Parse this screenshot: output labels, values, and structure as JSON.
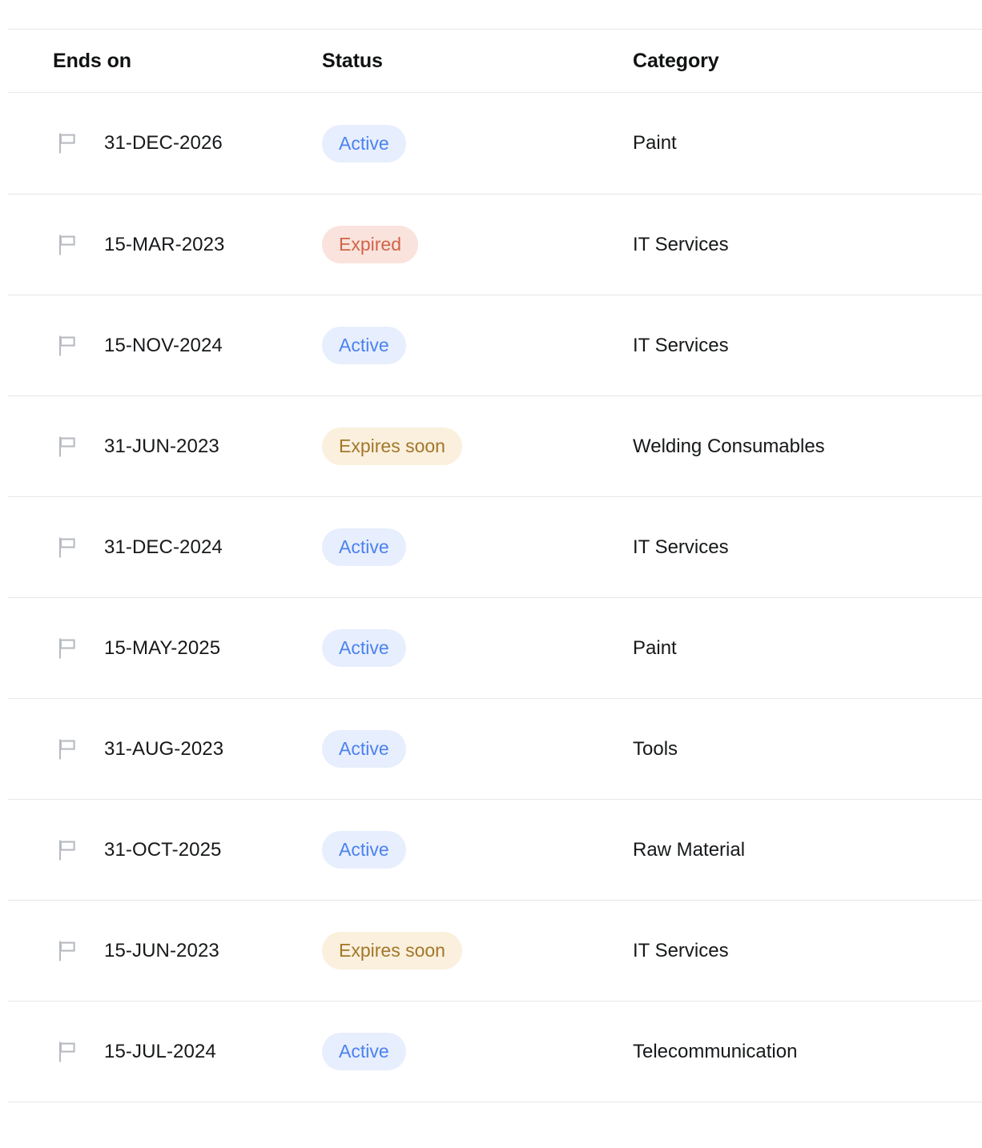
{
  "table": {
    "columns": [
      {
        "key": "ends_on",
        "label": "Ends on"
      },
      {
        "key": "status",
        "label": "Status"
      },
      {
        "key": "category",
        "label": "Category"
      }
    ],
    "row_icon": "flag-icon",
    "rows": [
      {
        "ends_on": "31-DEC-2026",
        "status": "Active",
        "status_kind": "active",
        "category": "Paint"
      },
      {
        "ends_on": "15-MAR-2023",
        "status": "Expired",
        "status_kind": "expired",
        "category": "IT Services"
      },
      {
        "ends_on": "15-NOV-2024",
        "status": "Active",
        "status_kind": "active",
        "category": "IT Services"
      },
      {
        "ends_on": "31-JUN-2023",
        "status": "Expires soon",
        "status_kind": "expires-soon",
        "category": "Welding Consumables"
      },
      {
        "ends_on": "31-DEC-2024",
        "status": "Active",
        "status_kind": "active",
        "category": "IT Services"
      },
      {
        "ends_on": "15-MAY-2025",
        "status": "Active",
        "status_kind": "active",
        "category": "Paint"
      },
      {
        "ends_on": "31-AUG-2023",
        "status": "Active",
        "status_kind": "active",
        "category": "Tools"
      },
      {
        "ends_on": "31-OCT-2025",
        "status": "Active",
        "status_kind": "active",
        "category": "Raw Material"
      },
      {
        "ends_on": "15-JUN-2023",
        "status": "Expires soon",
        "status_kind": "expires-soon",
        "category": "IT Services"
      },
      {
        "ends_on": "15-JUL-2024",
        "status": "Active",
        "status_kind": "active",
        "category": "Telecommunication"
      }
    ]
  },
  "colors": {
    "divider": "#e6e7e9",
    "text": "#16181a",
    "header_text": "#111213",
    "flag": "#b7bbc0",
    "active_bg": "#e7eefd",
    "active_fg": "#4b82f0",
    "expired_bg": "#fae3dc",
    "expired_fg": "#d1634a",
    "expires_soon_bg": "#faf0dd",
    "expires_soon_fg": "#a3762a"
  }
}
